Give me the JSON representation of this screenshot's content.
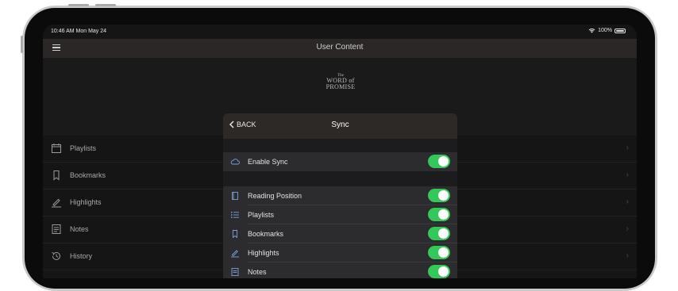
{
  "status_bar": {
    "time": "10:46 AM  Mon May 24",
    "wifi_icon": "wifi-icon",
    "battery": "100%"
  },
  "nav": {
    "title": "User Content",
    "menu_icon": "hamburger-menu-icon"
  },
  "logo": {
    "line1": "The",
    "line2": "WORD of",
    "line3": "PROMISE"
  },
  "content_list": {
    "items": [
      {
        "label": "Playlists",
        "icon": "calendar-icon"
      },
      {
        "label": "Bookmarks",
        "icon": "bookmark-icon"
      },
      {
        "label": "Highlights",
        "icon": "highlighter-icon"
      },
      {
        "label": "Notes",
        "icon": "notes-icon"
      },
      {
        "label": "History",
        "icon": "history-icon"
      }
    ]
  },
  "sync_modal": {
    "back_label": "BACK",
    "title": "Sync",
    "enable": {
      "label": "Enable Sync",
      "icon": "cloud-icon",
      "on": true
    },
    "items": [
      {
        "label": "Reading Position",
        "icon": "book-icon",
        "on": true
      },
      {
        "label": "Playlists",
        "icon": "list-icon",
        "on": true
      },
      {
        "label": "Bookmarks",
        "icon": "bookmark-icon",
        "on": true
      },
      {
        "label": "Highlights",
        "icon": "highlighter-icon",
        "on": true
      },
      {
        "label": "Notes",
        "icon": "notes-icon",
        "on": true
      }
    ]
  },
  "colors": {
    "toggle_on": "#34c759",
    "header_bg": "#2d2927",
    "nav_bg": "#2b2726"
  }
}
